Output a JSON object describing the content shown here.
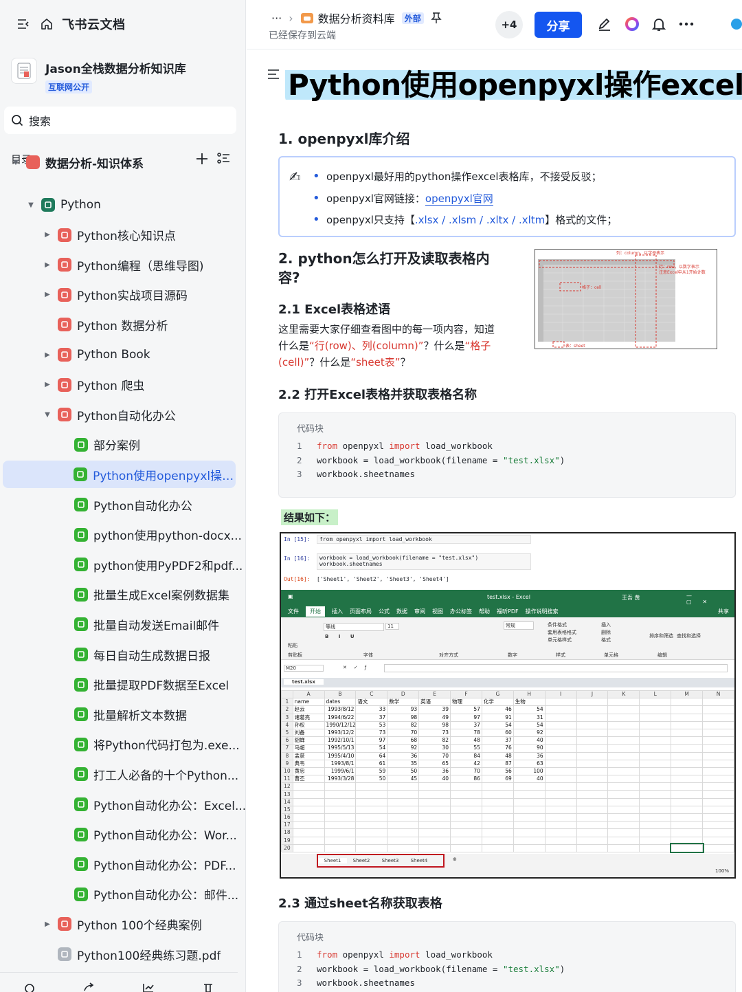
{
  "sidebar": {
    "brand": "飞书云文档",
    "space_name": "Jason全栈数据分析知识库",
    "space_badge": "互联网公开",
    "search_placeholder": "搜索",
    "toc_label": "目录",
    "root_label": "数据分析-知识体系",
    "tree": [
      {
        "label": "Python",
        "color": "#1f7a5c"
      },
      {
        "label": "Python核心知识点",
        "color": "#e8615a"
      },
      {
        "label": "Python编程（思维导图)",
        "color": "#e8615a"
      },
      {
        "label": "Python实战项目源码",
        "color": "#e8615a"
      },
      {
        "label": "Python 数据分析",
        "color": "#e8615a"
      },
      {
        "label": "Python Book",
        "color": "#e8615a"
      },
      {
        "label": "Python 爬虫",
        "color": "#e8615a"
      },
      {
        "label": "Python自动化办公",
        "color": "#e8615a"
      },
      {
        "label": "部分案例",
        "color": "#34b233"
      },
      {
        "label": "Python使用openpyxl操作...",
        "color": "#34b233"
      },
      {
        "label": "Python自动化办公",
        "color": "#34b233"
      },
      {
        "label": "python使用python-docx...",
        "color": "#34b233"
      },
      {
        "label": "python使用PyPDF2和pdf...",
        "color": "#34b233"
      },
      {
        "label": "批量生成Excel案例数据集",
        "color": "#34b233"
      },
      {
        "label": "批量自动发送Email邮件",
        "color": "#34b233"
      },
      {
        "label": "每日自动生成数据日报",
        "color": "#34b233"
      },
      {
        "label": "批量提取PDF数据至Excel",
        "color": "#34b233"
      },
      {
        "label": "批量解析文本数据",
        "color": "#34b233"
      },
      {
        "label": "将Python代码打包为.exe...",
        "color": "#34b233"
      },
      {
        "label": "打工人必备的十个Python...",
        "color": "#34b233"
      },
      {
        "label": "Python自动化办公：Excel...",
        "color": "#34b233"
      },
      {
        "label": "Python自动化办公：Wor...",
        "color": "#34b233"
      },
      {
        "label": "Python自动化办公：PDF...",
        "color": "#34b233"
      },
      {
        "label": "Python自动化办公：邮件...",
        "color": "#34b233"
      },
      {
        "label": "Python 100个经典案例",
        "color": "#e8615a"
      },
      {
        "label": "Python100经典练习题.pdf",
        "color": "#b0b6be"
      }
    ]
  },
  "topbar": {
    "breadcrumb_more": "···",
    "breadcrumb_space": "数据分析资料库",
    "breadcrumb_badge": "外部",
    "saved_status": "已经保存到云端",
    "collaborators": "+4",
    "share_label": "分享"
  },
  "doc": {
    "title": "Python使用openpyxl操作excel",
    "s1_heading": "1. openpyxl库介绍",
    "bullets": {
      "b1": "openpyxl最好用的python操作excel表格库，不接受反驳；",
      "b2_prefix": "openpyxl官网链接：",
      "b2_link": "openpyxl官网",
      "b3_a": "openpyxl只支持【",
      "b3_b": ".xlsx / .xlsm / .xltx / .xltm",
      "b3_c": "】格式的文件；"
    },
    "s2_heading_1": "2. python怎么打开及读取表格内",
    "s2_heading_2": "容?",
    "s21_heading": "2.1 Excel表格述语",
    "s21_text_1": "这里需要大家仔细查看图中的每一项内容，知道",
    "s21_text_2": "什么是",
    "s21_red_1": "“行(row)、列(column)”",
    "s21_text_3": "？什么是",
    "s21_red_2": "“格子",
    "s21_red_3": "(cell)”",
    "s21_text_4": "？什么是",
    "s21_red_4": "“sheet表”",
    "s21_text_5": "？",
    "fig": {
      "col_label": "列：column，以字母表示",
      "row_label_1": "行：row，以数字表示",
      "row_label_2": "注意Excel中从1开始计数",
      "cell_label": "格子：cell",
      "sheet_label": "表：sheet"
    },
    "s22_heading": "2.2 打开Excel表格并获取表格名称",
    "code_caption": "代码块",
    "code1": [
      {
        "n": "1",
        "kw": "from",
        "a": " openpyxl ",
        "kw2": "import",
        "b": " load_workbook",
        "s": "",
        "c": ""
      },
      {
        "n": "2",
        "kw": "",
        "a": "workbook = load_workbook(filename = ",
        "kw2": "",
        "b": "",
        "s": "\"test.xlsx\"",
        "c": ")"
      },
      {
        "n": "3",
        "kw": "",
        "a": "workbook.sheetnames",
        "kw2": "",
        "b": "",
        "s": "",
        "c": ""
      }
    ],
    "result_label": "结果如下：",
    "s23_heading": "2.3 通过sheet名称获取表格"
  },
  "notebook": {
    "in15": "In  [15]:",
    "in15_code": "from openpyxl import load_workbook",
    "in16": "In  [16]:",
    "in16_code_1": "workbook = load_workbook(filename = \"test.xlsx\")",
    "in16_code_2": "workbook.sheetnames",
    "out16": "Out[16]:",
    "out16_val": "['Sheet1', 'Sheet2', 'Sheet3', 'Sheet4']"
  },
  "excel": {
    "window_title": "test.xlsx - Excel",
    "user": "王吾 黄",
    "tabs": [
      "文件",
      "开始",
      "插入",
      "页面布局",
      "公式",
      "数据",
      "审阅",
      "视图",
      "办公标签",
      "帮助",
      "福昕PDF",
      "操作说明搜索"
    ],
    "share": "共享",
    "name_box": "M20",
    "file_tab": "test.xlsx",
    "font_name": "等线",
    "font_size": "11",
    "number_format": "常规",
    "ribbon_groups": [
      "剪贴板",
      "字体",
      "对齐方式",
      "数字",
      "样式",
      "单元格",
      "编辑"
    ],
    "cond_format": "条件格式",
    "table_format": "套用表格格式",
    "cell_style": "单元格样式",
    "insert": "插入",
    "delete": "删除",
    "format": "格式",
    "sort_filter": "排序和筛选",
    "find_select": "查找和选择",
    "paste": "粘贴",
    "columns": [
      "A",
      "B",
      "C",
      "D",
      "E",
      "F",
      "G",
      "H",
      "I",
      "J",
      "K",
      "L",
      "M",
      "N"
    ],
    "header_row": [
      "name",
      "dates",
      "语文",
      "数学",
      "英语",
      "物理",
      "化学",
      "生物"
    ],
    "rows": [
      [
        "赵云",
        "1993/8/12",
        "33",
        "93",
        "39",
        "57",
        "46",
        "54"
      ],
      [
        "诸葛亮",
        "1994/6/22",
        "37",
        "98",
        "49",
        "97",
        "91",
        "31"
      ],
      [
        "孙权",
        "1990/12/12",
        "53",
        "82",
        "98",
        "37",
        "54",
        "54"
      ],
      [
        "刘备",
        "1993/12/2",
        "73",
        "70",
        "73",
        "78",
        "60",
        "92"
      ],
      [
        "貂蝉",
        "1992/10/1",
        "97",
        "68",
        "82",
        "48",
        "37",
        "40"
      ],
      [
        "马超",
        "1995/5/13",
        "54",
        "92",
        "30",
        "55",
        "76",
        "90"
      ],
      [
        "孟获",
        "1995/4/10",
        "64",
        "36",
        "70",
        "84",
        "48",
        "36"
      ],
      [
        "典韦",
        "1993/8/1",
        "61",
        "35",
        "65",
        "42",
        "87",
        "63"
      ],
      [
        "黄忠",
        "1999/6/1",
        "59",
        "50",
        "36",
        "70",
        "56",
        "100"
      ],
      [
        "曹丕",
        "1993/3/28",
        "50",
        "45",
        "40",
        "86",
        "69",
        "40"
      ]
    ],
    "row_numbers": [
      "1",
      "2",
      "3",
      "4",
      "5",
      "6",
      "7",
      "8",
      "9",
      "10",
      "11",
      "12",
      "13",
      "14",
      "15",
      "16",
      "17",
      "18",
      "19",
      "20"
    ],
    "sheets": [
      "Sheet1",
      "Sheet2",
      "Sheet3",
      "Sheet4"
    ],
    "zoom": "100%"
  },
  "code2": [
    {
      "n": "1",
      "kw": "from",
      "a": " openpyxl ",
      "kw2": "import",
      "b": " load_workbook",
      "s": "",
      "c": ""
    },
    {
      "n": "2",
      "kw": "",
      "a": "workbook = load_workbook(filename = ",
      "kw2": "",
      "b": "",
      "s": "\"test.xlsx\"",
      "c": ")"
    },
    {
      "n": "3",
      "kw": "",
      "a": "workbook.sheetnames",
      "kw2": "",
      "b": "",
      "s": "",
      "c": ""
    }
  ]
}
